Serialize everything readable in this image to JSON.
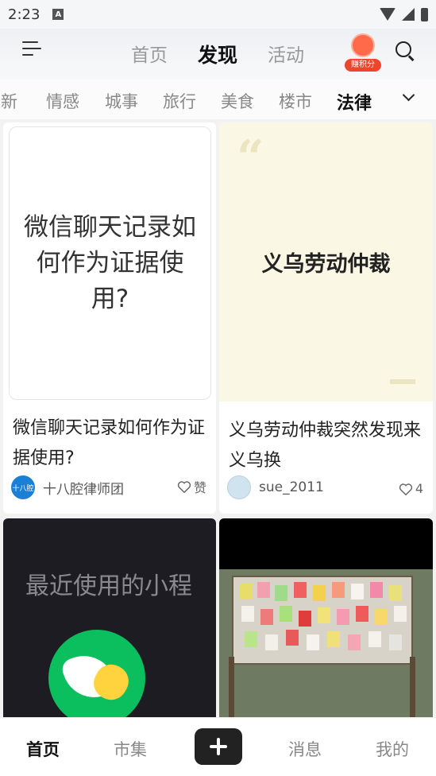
{
  "status_bar": {
    "time": "2:23",
    "notification_icon": "A"
  },
  "top_nav": {
    "tabs": [
      "首页",
      "发现",
      "活动"
    ],
    "active_tab": "发现",
    "points_badge_label": "赚积分"
  },
  "categories": {
    "items": [
      "最新",
      "情感",
      "城事",
      "旅行",
      "美食",
      "楼市",
      "法律"
    ],
    "active": "法律"
  },
  "feed": {
    "cards": [
      {
        "cover_text": "微信聊天记录如何作为证据使用?",
        "title": "微信聊天记录如何作为证据使用?",
        "author": "十八腔律师团",
        "avatar_text": "十八腔",
        "likes": "赞"
      },
      {
        "cover_text": "义乌劳动仲裁",
        "title": "义乌劳动仲裁突然发现来义乌换",
        "author": "sue_2011",
        "likes": "4"
      },
      {
        "cover_text": "最近使用的小程"
      },
      {}
    ]
  },
  "bottom_nav": {
    "items": [
      "首页",
      "市集",
      "消息",
      "我的"
    ],
    "active": "首页"
  },
  "colors": {
    "accent": "#111111",
    "inactive": "#888888",
    "points": "#f0442c",
    "miniprogram_green": "#0bbf5e"
  }
}
